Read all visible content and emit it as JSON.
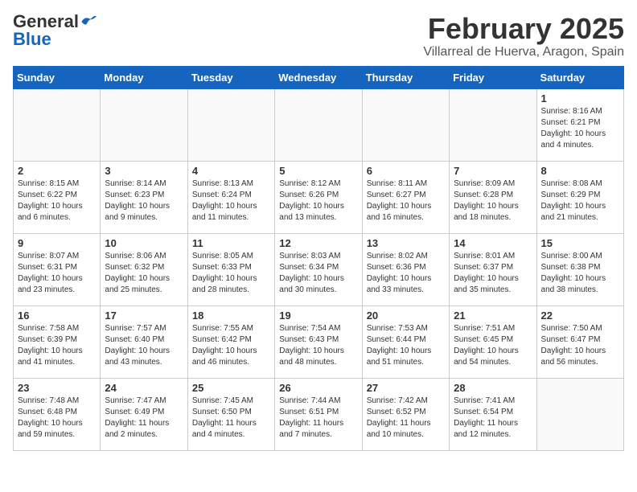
{
  "header": {
    "logo_general": "General",
    "logo_blue": "Blue",
    "month_title": "February 2025",
    "location": "Villarreal de Huerva, Aragon, Spain"
  },
  "days_of_week": [
    "Sunday",
    "Monday",
    "Tuesday",
    "Wednesday",
    "Thursday",
    "Friday",
    "Saturday"
  ],
  "weeks": [
    [
      {
        "day": "",
        "info": ""
      },
      {
        "day": "",
        "info": ""
      },
      {
        "day": "",
        "info": ""
      },
      {
        "day": "",
        "info": ""
      },
      {
        "day": "",
        "info": ""
      },
      {
        "day": "",
        "info": ""
      },
      {
        "day": "1",
        "info": "Sunrise: 8:16 AM\nSunset: 6:21 PM\nDaylight: 10 hours and 4 minutes."
      }
    ],
    [
      {
        "day": "2",
        "info": "Sunrise: 8:15 AM\nSunset: 6:22 PM\nDaylight: 10 hours and 6 minutes."
      },
      {
        "day": "3",
        "info": "Sunrise: 8:14 AM\nSunset: 6:23 PM\nDaylight: 10 hours and 9 minutes."
      },
      {
        "day": "4",
        "info": "Sunrise: 8:13 AM\nSunset: 6:24 PM\nDaylight: 10 hours and 11 minutes."
      },
      {
        "day": "5",
        "info": "Sunrise: 8:12 AM\nSunset: 6:26 PM\nDaylight: 10 hours and 13 minutes."
      },
      {
        "day": "6",
        "info": "Sunrise: 8:11 AM\nSunset: 6:27 PM\nDaylight: 10 hours and 16 minutes."
      },
      {
        "day": "7",
        "info": "Sunrise: 8:09 AM\nSunset: 6:28 PM\nDaylight: 10 hours and 18 minutes."
      },
      {
        "day": "8",
        "info": "Sunrise: 8:08 AM\nSunset: 6:29 PM\nDaylight: 10 hours and 21 minutes."
      }
    ],
    [
      {
        "day": "9",
        "info": "Sunrise: 8:07 AM\nSunset: 6:31 PM\nDaylight: 10 hours and 23 minutes."
      },
      {
        "day": "10",
        "info": "Sunrise: 8:06 AM\nSunset: 6:32 PM\nDaylight: 10 hours and 25 minutes."
      },
      {
        "day": "11",
        "info": "Sunrise: 8:05 AM\nSunset: 6:33 PM\nDaylight: 10 hours and 28 minutes."
      },
      {
        "day": "12",
        "info": "Sunrise: 8:03 AM\nSunset: 6:34 PM\nDaylight: 10 hours and 30 minutes."
      },
      {
        "day": "13",
        "info": "Sunrise: 8:02 AM\nSunset: 6:36 PM\nDaylight: 10 hours and 33 minutes."
      },
      {
        "day": "14",
        "info": "Sunrise: 8:01 AM\nSunset: 6:37 PM\nDaylight: 10 hours and 35 minutes."
      },
      {
        "day": "15",
        "info": "Sunrise: 8:00 AM\nSunset: 6:38 PM\nDaylight: 10 hours and 38 minutes."
      }
    ],
    [
      {
        "day": "16",
        "info": "Sunrise: 7:58 AM\nSunset: 6:39 PM\nDaylight: 10 hours and 41 minutes."
      },
      {
        "day": "17",
        "info": "Sunrise: 7:57 AM\nSunset: 6:40 PM\nDaylight: 10 hours and 43 minutes."
      },
      {
        "day": "18",
        "info": "Sunrise: 7:55 AM\nSunset: 6:42 PM\nDaylight: 10 hours and 46 minutes."
      },
      {
        "day": "19",
        "info": "Sunrise: 7:54 AM\nSunset: 6:43 PM\nDaylight: 10 hours and 48 minutes."
      },
      {
        "day": "20",
        "info": "Sunrise: 7:53 AM\nSunset: 6:44 PM\nDaylight: 10 hours and 51 minutes."
      },
      {
        "day": "21",
        "info": "Sunrise: 7:51 AM\nSunset: 6:45 PM\nDaylight: 10 hours and 54 minutes."
      },
      {
        "day": "22",
        "info": "Sunrise: 7:50 AM\nSunset: 6:47 PM\nDaylight: 10 hours and 56 minutes."
      }
    ],
    [
      {
        "day": "23",
        "info": "Sunrise: 7:48 AM\nSunset: 6:48 PM\nDaylight: 10 hours and 59 minutes."
      },
      {
        "day": "24",
        "info": "Sunrise: 7:47 AM\nSunset: 6:49 PM\nDaylight: 11 hours and 2 minutes."
      },
      {
        "day": "25",
        "info": "Sunrise: 7:45 AM\nSunset: 6:50 PM\nDaylight: 11 hours and 4 minutes."
      },
      {
        "day": "26",
        "info": "Sunrise: 7:44 AM\nSunset: 6:51 PM\nDaylight: 11 hours and 7 minutes."
      },
      {
        "day": "27",
        "info": "Sunrise: 7:42 AM\nSunset: 6:52 PM\nDaylight: 11 hours and 10 minutes."
      },
      {
        "day": "28",
        "info": "Sunrise: 7:41 AM\nSunset: 6:54 PM\nDaylight: 11 hours and 12 minutes."
      },
      {
        "day": "",
        "info": ""
      }
    ]
  ]
}
